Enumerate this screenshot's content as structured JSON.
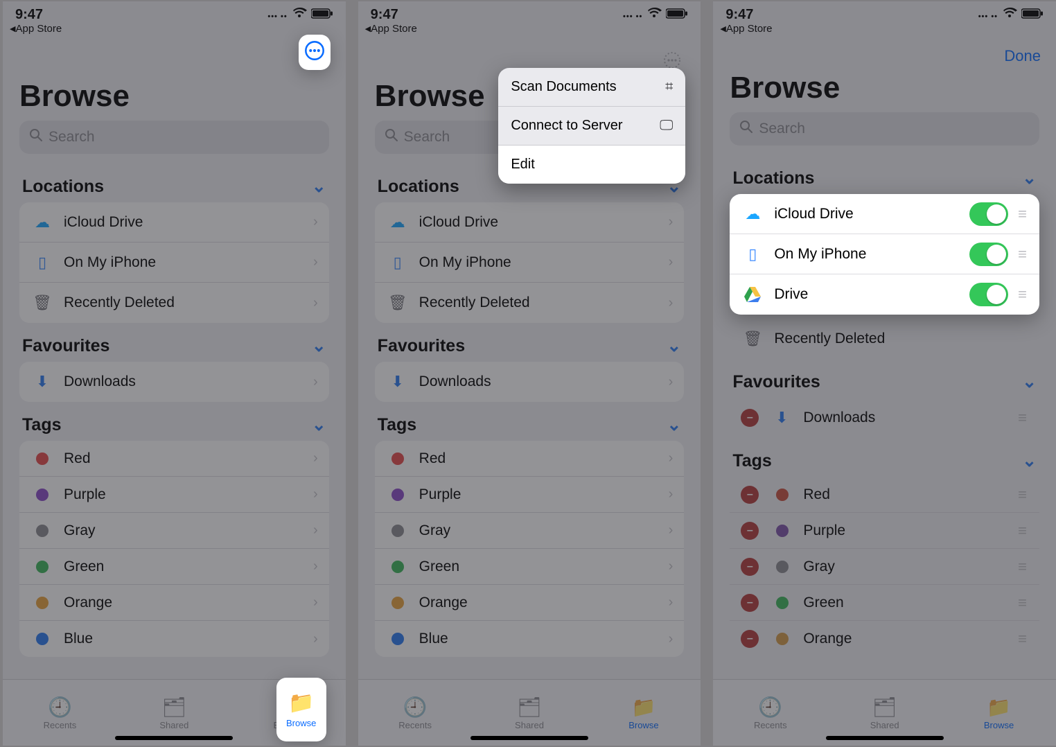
{
  "status": {
    "time": "9:47",
    "back_app": "App Store"
  },
  "colors": {
    "ios_blue": "#0a6cff",
    "toggle_green": "#34c759"
  },
  "common": {
    "page_title": "Browse",
    "search_placeholder": "Search",
    "sections": {
      "locations": "Locations",
      "favourites": "Favourites",
      "tags": "Tags"
    },
    "locations": [
      {
        "label": "iCloud Drive",
        "icon": "cloud"
      },
      {
        "label": "On My iPhone",
        "icon": "iphone"
      },
      {
        "label": "Recently Deleted",
        "icon": "trash"
      }
    ],
    "favourites": [
      {
        "label": "Downloads",
        "icon": "download"
      }
    ],
    "tags": [
      {
        "label": "Red",
        "color": "#e64b4b"
      },
      {
        "label": "Purple",
        "color": "#8a4bc8"
      },
      {
        "label": "Gray",
        "color": "#8a8a90"
      },
      {
        "label": "Green",
        "color": "#3cb65a"
      },
      {
        "label": "Orange",
        "color": "#e8a33d"
      },
      {
        "label": "Blue",
        "color": "#2a7af0"
      }
    ],
    "tabs": {
      "recents": "Recents",
      "shared": "Shared",
      "browse": "Browse"
    }
  },
  "panel2": {
    "menu": {
      "scan": "Scan Documents",
      "connect": "Connect to Server",
      "edit": "Edit"
    }
  },
  "panel3": {
    "done": "Done",
    "edit_locations": [
      {
        "label": "iCloud Drive",
        "icon": "cloud",
        "on": true
      },
      {
        "label": "On My iPhone",
        "icon": "iphone",
        "on": true
      },
      {
        "label": "Drive",
        "icon": "gdrive",
        "on": true
      }
    ],
    "recently_deleted": "Recently Deleted",
    "favourites": [
      {
        "label": "Downloads",
        "icon": "download"
      }
    ],
    "tags": [
      {
        "label": "Red",
        "color": "#c8503f"
      },
      {
        "label": "Purple",
        "color": "#7d52a8"
      },
      {
        "label": "Gray",
        "color": "#8a8a90"
      },
      {
        "label": "Green",
        "color": "#3cb65a"
      },
      {
        "label": "Orange",
        "color": "#d29a48"
      }
    ]
  }
}
